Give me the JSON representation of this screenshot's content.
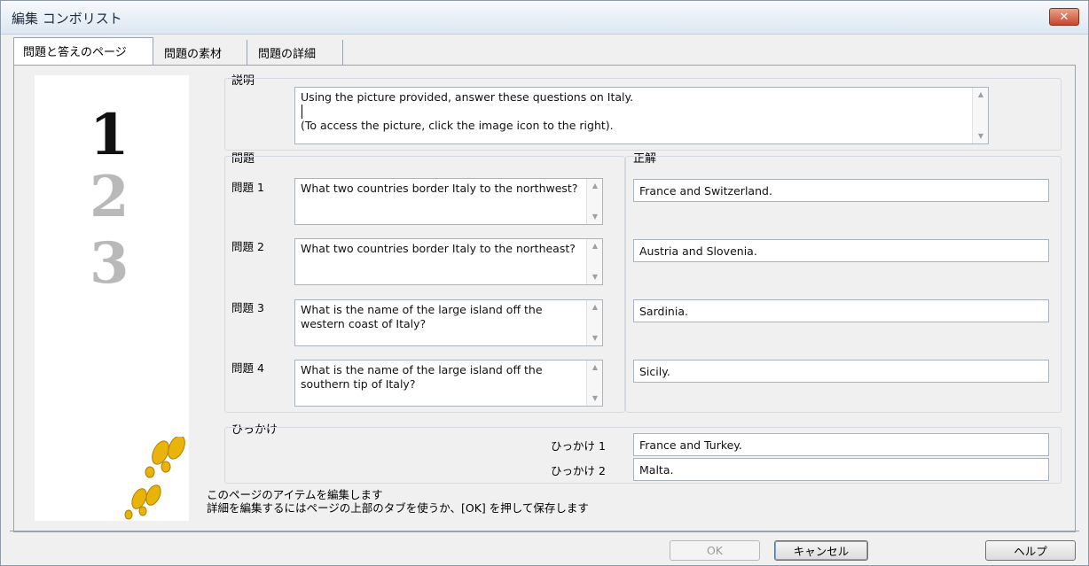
{
  "window": {
    "title": "編集 コンボリスト",
    "close_label": "✕"
  },
  "tabs": [
    {
      "label": "問題と答えのページ"
    },
    {
      "label": "問題の素材"
    },
    {
      "label": "問題の詳細"
    }
  ],
  "image_numbers": [
    "1",
    "2",
    "3"
  ],
  "description": {
    "label": "説明",
    "line1": "Using the picture provided, answer these questions on Italy.",
    "line2": "(To access the picture, click the image icon to the right)."
  },
  "questions": {
    "label": "問題",
    "answers_label": "正解",
    "items": [
      {
        "label": "問題 1",
        "question": "What two countries border Italy to the northwest?",
        "answer": "France and Switzerland."
      },
      {
        "label": "問題 2",
        "question": "What two countries border Italy to the northeast?",
        "answer": "Austria and Slovenia."
      },
      {
        "label": "問題 3",
        "question": "What is the name of the large island off the western coast of Italy?",
        "answer": "Sardinia."
      },
      {
        "label": "問題 4",
        "question": "What is the name of the large island off the southern tip of Italy?",
        "answer": "Sicily."
      }
    ]
  },
  "distractors": {
    "label": "ひっかけ",
    "items": [
      {
        "label": "ひっかけ 1",
        "value": "France and Turkey."
      },
      {
        "label": "ひっかけ 2",
        "value": "Malta."
      }
    ]
  },
  "hint": {
    "line1": "このページのアイテムを編集します",
    "line2": "詳細を編集するにはページの上部のタブを使うか、[OK] を押して保存します"
  },
  "buttons": {
    "ok": "OK",
    "cancel": "キャンセル",
    "help": "ヘルプ"
  },
  "icons": {
    "scroll_up": "▲",
    "scroll_down": "▼"
  },
  "colors": {
    "footprint": "#e8b40c"
  }
}
